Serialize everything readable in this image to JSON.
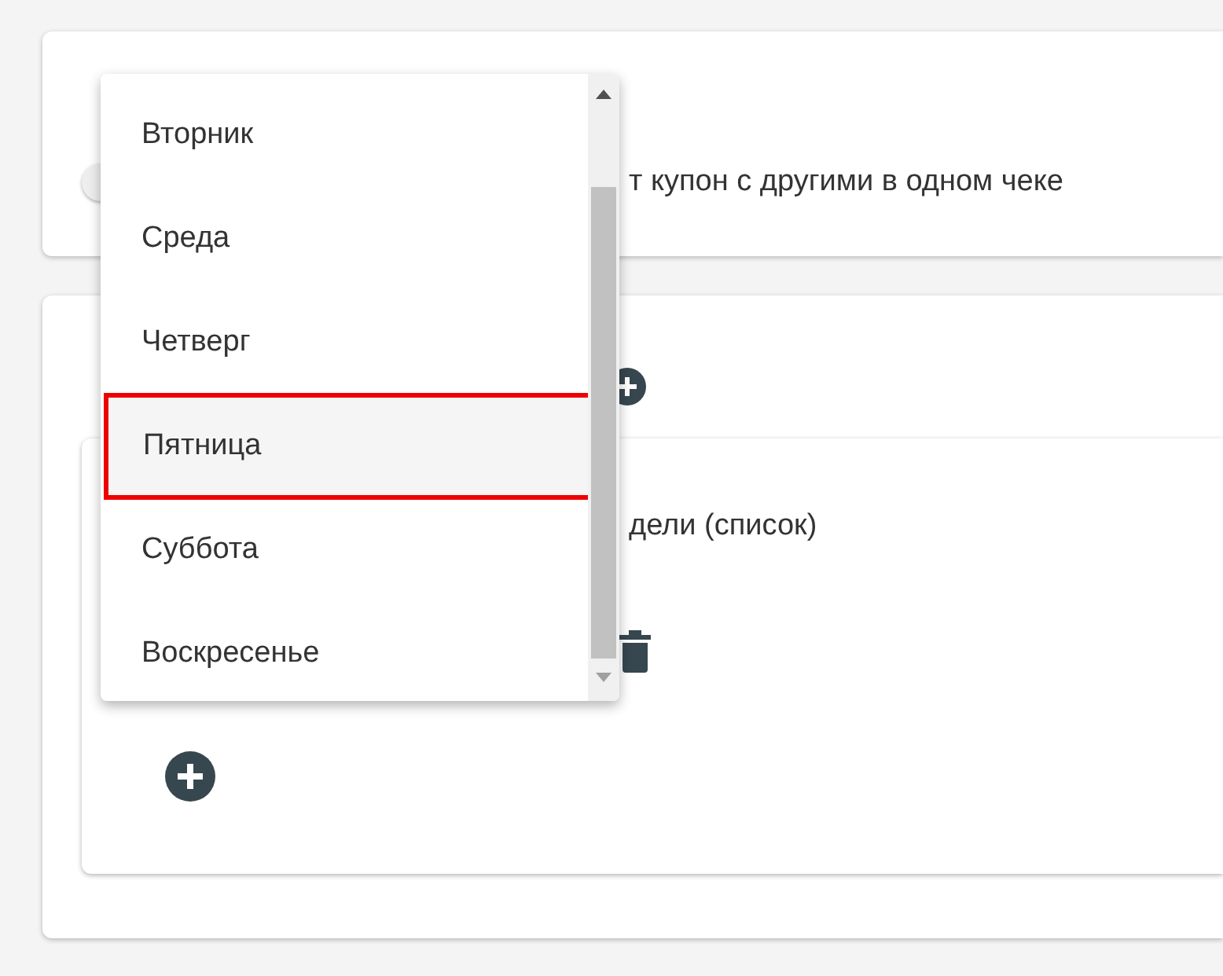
{
  "card_1": {
    "toggle": {
      "on": false
    },
    "toggle_label": "т купон с другими в одном чеке"
  },
  "card_2": {
    "rule": {
      "label": "дели (список)"
    }
  },
  "dropdown": {
    "items": [
      {
        "label": "Вторник",
        "selected": false
      },
      {
        "label": "Среда",
        "selected": false
      },
      {
        "label": "Четверг",
        "selected": false
      },
      {
        "label": "Пятница",
        "selected": true
      },
      {
        "label": "Суббота",
        "selected": false
      },
      {
        "label": "Воскресенье",
        "selected": false
      }
    ]
  }
}
